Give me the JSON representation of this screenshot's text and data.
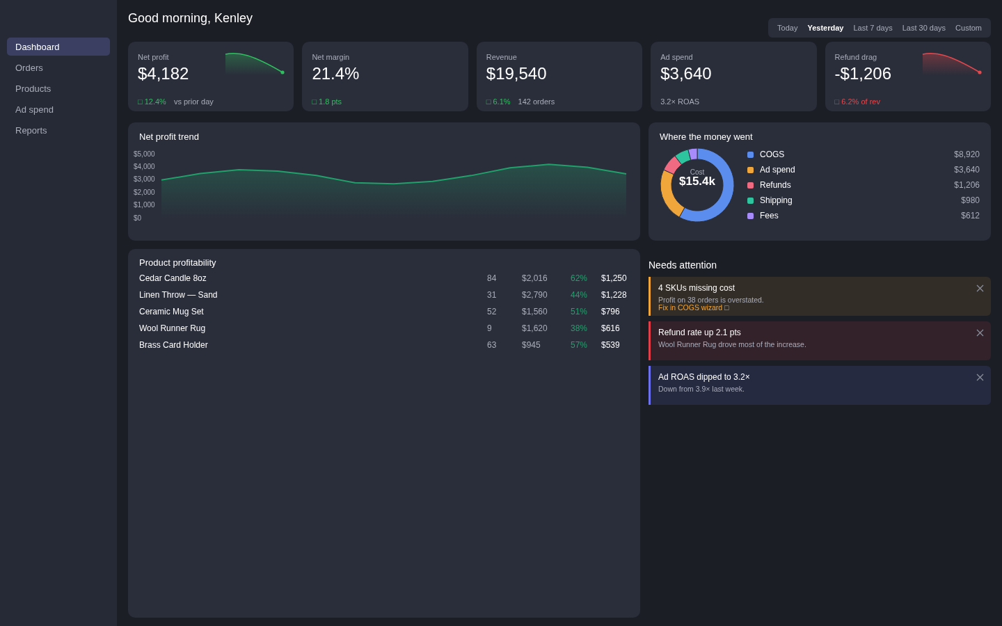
{
  "sidebar": {
    "items": [
      {
        "label": "Dashboard",
        "selected": true
      },
      {
        "label": "Orders",
        "selected": false
      },
      {
        "label": "Products",
        "selected": false
      },
      {
        "label": "Ad spend",
        "selected": false
      },
      {
        "label": "Reports",
        "selected": false
      }
    ]
  },
  "header": {
    "greeting": "Good morning, Kenley",
    "date_range": [
      {
        "label": "Today",
        "selected": false
      },
      {
        "label": "Yesterday",
        "selected": true
      },
      {
        "label": "Last 7 days",
        "selected": false
      },
      {
        "label": "Last 30 days",
        "selected": false
      },
      {
        "label": "Custom",
        "selected": false
      }
    ]
  },
  "kpis": [
    {
      "label": "Net profit",
      "value": "$4,182",
      "delta": "□ 12.4%",
      "note": "vs prior day",
      "negative": false,
      "sparkline": true
    },
    {
      "label": "Net margin",
      "value": "21.4%",
      "delta": "□ 1.8 pts",
      "negative": false,
      "sparkline": false
    },
    {
      "label": "Revenue",
      "value": "$19,540",
      "delta": "□ 6.1%",
      "note": "142 orders",
      "negative": false,
      "sparkline": false
    },
    {
      "label": "Ad spend",
      "value": "$3,640",
      "note": "3.2× ROAS",
      "sparkline": false
    },
    {
      "label": "Refund drag",
      "value": "-$1,206",
      "delta": "□ 6.2% of rev",
      "negative": true,
      "sparkline": true
    }
  ],
  "trend": {
    "title": "Net profit trend",
    "chart_data": {
      "type": "area",
      "categories": [
        null,
        null,
        null,
        null,
        null,
        null,
        null,
        null,
        null,
        null,
        null,
        null,
        null
      ],
      "series": [
        {
          "color": "#22a06b",
          "values": [
            3000,
            3500,
            3800,
            3700,
            3350,
            2780,
            2700,
            2900,
            3350,
            3950,
            4230,
            4000,
            3480
          ]
        }
      ],
      "ylim": [
        0,
        5000
      ],
      "yticks": [
        {
          "value": 0,
          "label": "$0"
        },
        {
          "value": 1000,
          "label": "$1,000"
        },
        {
          "value": 2000,
          "label": "$2,000"
        },
        {
          "value": 3000,
          "label": "$3,000"
        },
        {
          "value": 4000,
          "label": "$4,000"
        },
        {
          "value": 5000,
          "label": "$5,000"
        }
      ]
    }
  },
  "money": {
    "title": "Where the money went",
    "center_label": "Cost",
    "center_value": "$15.4k",
    "legend": [
      {
        "value": "$8,920",
        "color": "#5b8def"
      },
      {
        "value": "$3,640",
        "color": "#f0a63a"
      },
      {
        "value": "$1,206",
        "color": "#f06b81"
      },
      {
        "value": "$980",
        "color": "#2ec4a0"
      },
      {
        "value": "$612",
        "color": "#a78bfa"
      }
    ],
    "chart_data": {
      "type": "donut",
      "categories": [
        "COGS",
        "Ad spend",
        "Refunds",
        "Shipping",
        "Fees"
      ],
      "values": [
        58.1,
        23.7,
        7.8,
        6.4,
        4.0
      ]
    }
  },
  "products": {
    "title": "Product profitability",
    "rows": [
      {
        "cells": [
          "Cedar Candle 8oz",
          "84",
          "$2,016",
          "62%",
          "$1,250"
        ]
      },
      {
        "cells": [
          "Linen Throw — Sand",
          "31",
          "$2,790",
          "44%",
          "$1,228"
        ]
      },
      {
        "cells": [
          "Ceramic Mug Set",
          "52",
          "$1,560",
          "51%",
          "$796"
        ]
      },
      {
        "cells": [
          "Wool Runner Rug",
          "9",
          "$1,620",
          "38%",
          "$616"
        ]
      },
      {
        "cells": [
          "Brass Card Holder",
          "63",
          "$945",
          "57%",
          "$539"
        ]
      }
    ]
  },
  "attention": {
    "title": "Needs attention",
    "alerts": [
      {
        "kind": "warning",
        "title": "4 SKUs missing cost",
        "text": "Profit on 38 orders is overstated.",
        "link": "Fix in COGS wizard □"
      },
      {
        "kind": "error",
        "title": "Refund rate up 2.1 pts",
        "text": "Wool Runner Rug drove most of the increase."
      },
      {
        "kind": "info",
        "title": "Ad ROAS dipped to 3.2×",
        "text": "Down from 3.9× last week."
      }
    ]
  }
}
